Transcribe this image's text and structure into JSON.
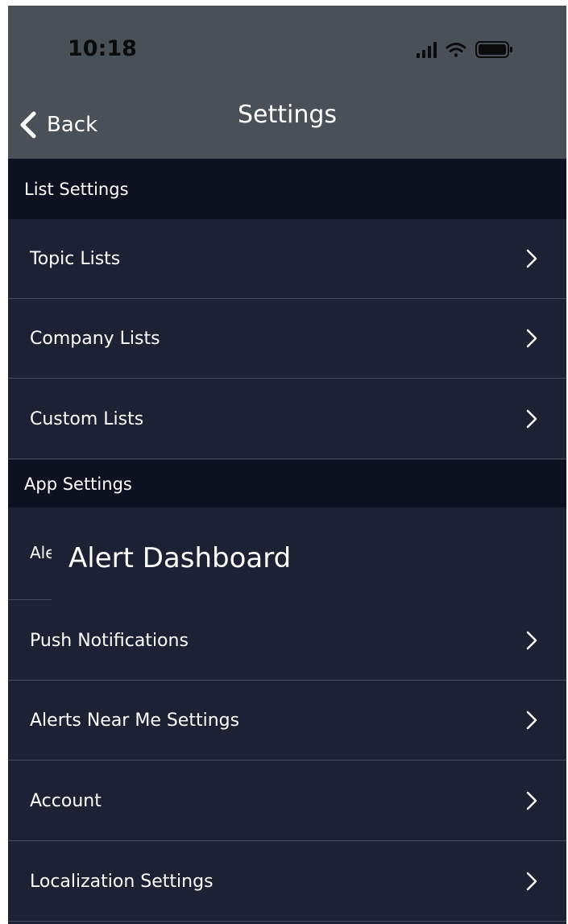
{
  "status_bar": {
    "time": "10:18",
    "icons": [
      "signal-icon",
      "wifi-icon",
      "battery-icon"
    ]
  },
  "nav": {
    "back_label": "Back",
    "title": "Settings"
  },
  "sections": [
    {
      "title": "List Settings",
      "items": [
        "Topic Lists",
        "Company Lists",
        "Custom Lists"
      ]
    },
    {
      "title": "App Settings",
      "truncated_item": "Ale",
      "tooltip": "Alert Dashboard",
      "items": [
        "Push Notifications",
        "Alerts Near Me Settings",
        "Account",
        "Localization Settings"
      ]
    }
  ],
  "colors": {
    "header_bg": "#4a5058",
    "section_bg": "#0d1120",
    "row_bg": "#1c2233",
    "divider": "#484d5d",
    "text": "#ffffff"
  }
}
